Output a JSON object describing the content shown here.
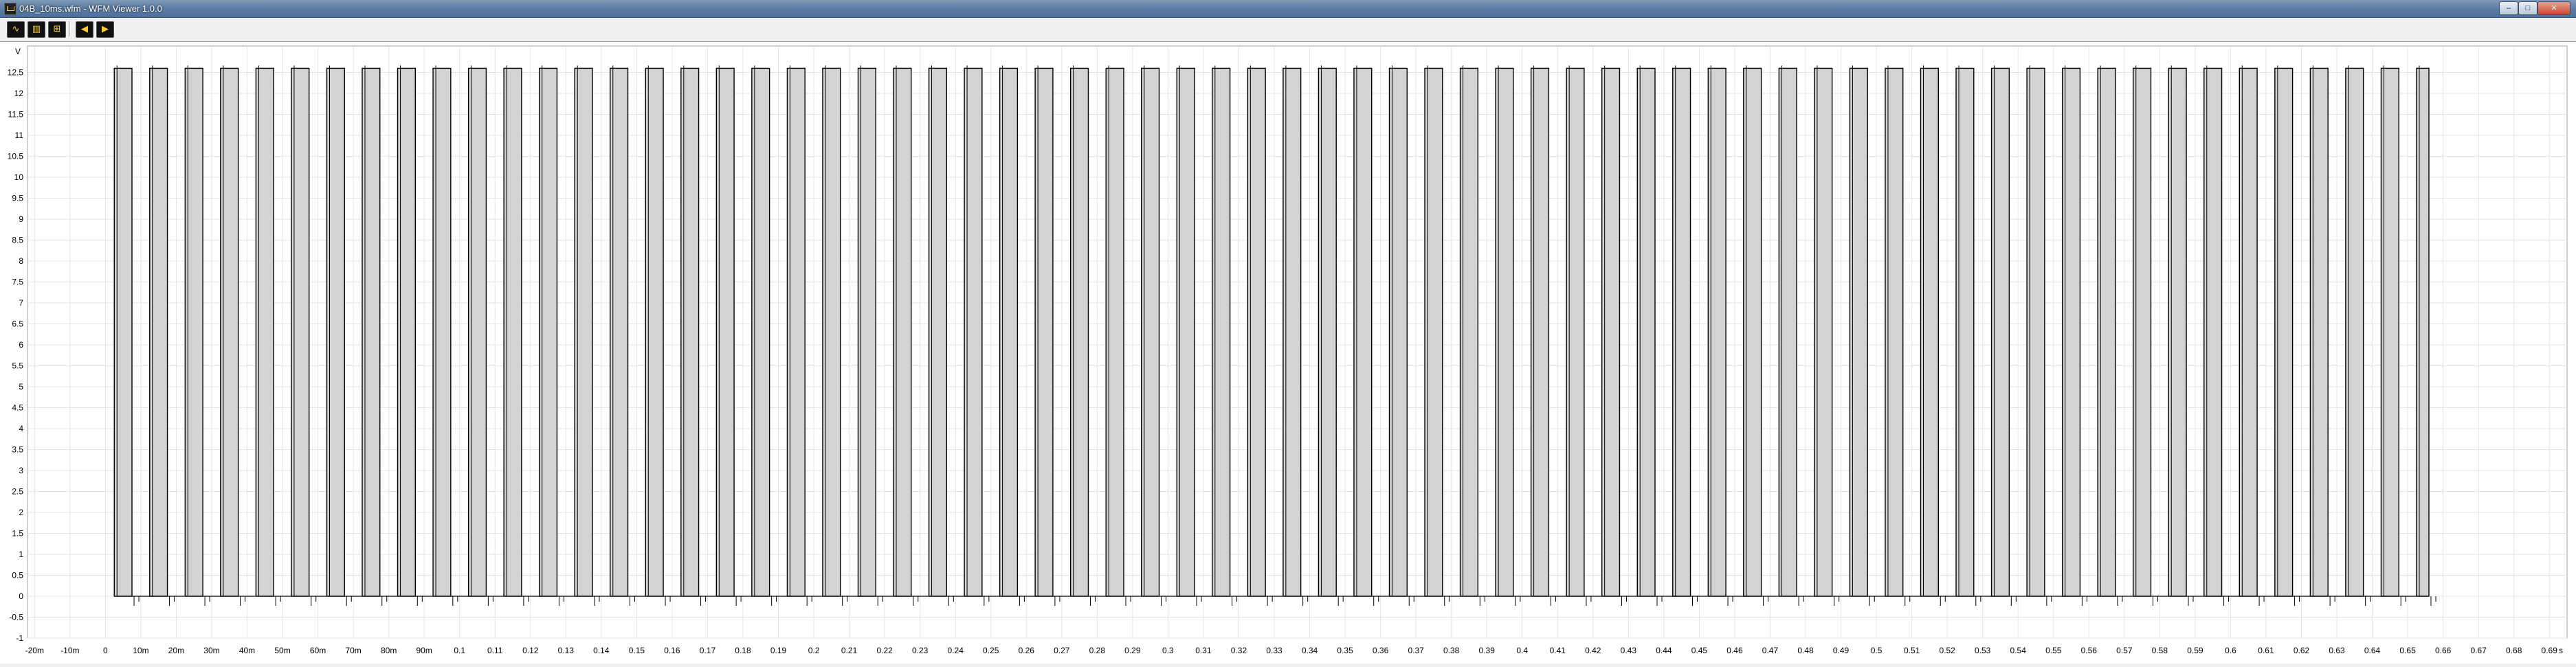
{
  "window": {
    "title": "04B_10ms.wfm - WFM Viewer 1.0.0",
    "minimize_label": "–",
    "maximize_label": "□",
    "close_label": "✕"
  },
  "toolbar": {
    "buttons": [
      {
        "name": "waveform-view-icon",
        "glyph": "∿"
      },
      {
        "name": "bar-chart-icon",
        "glyph": "▥"
      },
      {
        "name": "zoom-icon",
        "glyph": "⊞"
      },
      {
        "name": "arrow-left-icon",
        "glyph": "◀"
      },
      {
        "name": "arrow-right-icon",
        "glyph": "▶"
      }
    ]
  },
  "chart_data": {
    "type": "line",
    "ylabel": "V",
    "xlabel": "s",
    "ylim": [
      -1,
      13
    ],
    "xlim": [
      -0.022,
      0.695
    ],
    "y_ticks": [
      "-1",
      "-0.5",
      "0",
      "0.5",
      "1",
      "1.5",
      "2",
      "2.5",
      "3",
      "3.5",
      "4",
      "4.5",
      "5",
      "5.5",
      "6",
      "6.5",
      "7",
      "7.5",
      "8",
      "8.5",
      "9",
      "9.5",
      "10",
      "10.5",
      "11",
      "11.5",
      "12",
      "12.5"
    ],
    "x_ticks": [
      {
        "v": -0.02,
        "label": "-20m"
      },
      {
        "v": -0.01,
        "label": "-10m"
      },
      {
        "v": 0,
        "label": "0"
      },
      {
        "v": 0.01,
        "label": "10m"
      },
      {
        "v": 0.02,
        "label": "20m"
      },
      {
        "v": 0.03,
        "label": "30m"
      },
      {
        "v": 0.04,
        "label": "40m"
      },
      {
        "v": 0.05,
        "label": "50m"
      },
      {
        "v": 0.06,
        "label": "60m"
      },
      {
        "v": 0.07,
        "label": "70m"
      },
      {
        "v": 0.08,
        "label": "80m"
      },
      {
        "v": 0.09,
        "label": "90m"
      },
      {
        "v": 0.1,
        "label": "0.1"
      },
      {
        "v": 0.11,
        "label": "0.11"
      },
      {
        "v": 0.12,
        "label": "0.12"
      },
      {
        "v": 0.13,
        "label": "0.13"
      },
      {
        "v": 0.14,
        "label": "0.14"
      },
      {
        "v": 0.15,
        "label": "0.15"
      },
      {
        "v": 0.16,
        "label": "0.16"
      },
      {
        "v": 0.17,
        "label": "0.17"
      },
      {
        "v": 0.18,
        "label": "0.18"
      },
      {
        "v": 0.19,
        "label": "0.19"
      },
      {
        "v": 0.2,
        "label": "0.2"
      },
      {
        "v": 0.21,
        "label": "0.21"
      },
      {
        "v": 0.22,
        "label": "0.22"
      },
      {
        "v": 0.23,
        "label": "0.23"
      },
      {
        "v": 0.24,
        "label": "0.24"
      },
      {
        "v": 0.25,
        "label": "0.25"
      },
      {
        "v": 0.26,
        "label": "0.26"
      },
      {
        "v": 0.27,
        "label": "0.27"
      },
      {
        "v": 0.28,
        "label": "0.28"
      },
      {
        "v": 0.29,
        "label": "0.29"
      },
      {
        "v": 0.3,
        "label": "0.3"
      },
      {
        "v": 0.31,
        "label": "0.31"
      },
      {
        "v": 0.32,
        "label": "0.32"
      },
      {
        "v": 0.33,
        "label": "0.33"
      },
      {
        "v": 0.34,
        "label": "0.34"
      },
      {
        "v": 0.35,
        "label": "0.35"
      },
      {
        "v": 0.36,
        "label": "0.36"
      },
      {
        "v": 0.37,
        "label": "0.37"
      },
      {
        "v": 0.38,
        "label": "0.38"
      },
      {
        "v": 0.39,
        "label": "0.39"
      },
      {
        "v": 0.4,
        "label": "0.4"
      },
      {
        "v": 0.41,
        "label": "0.41"
      },
      {
        "v": 0.42,
        "label": "0.42"
      },
      {
        "v": 0.43,
        "label": "0.43"
      },
      {
        "v": 0.44,
        "label": "0.44"
      },
      {
        "v": 0.45,
        "label": "0.45"
      },
      {
        "v": 0.46,
        "label": "0.46"
      },
      {
        "v": 0.47,
        "label": "0.47"
      },
      {
        "v": 0.48,
        "label": "0.48"
      },
      {
        "v": 0.49,
        "label": "0.49"
      },
      {
        "v": 0.5,
        "label": "0.5"
      },
      {
        "v": 0.51,
        "label": "0.51"
      },
      {
        "v": 0.52,
        "label": "0.52"
      },
      {
        "v": 0.53,
        "label": "0.53"
      },
      {
        "v": 0.54,
        "label": "0.54"
      },
      {
        "v": 0.55,
        "label": "0.55"
      },
      {
        "v": 0.56,
        "label": "0.56"
      },
      {
        "v": 0.57,
        "label": "0.57"
      },
      {
        "v": 0.58,
        "label": "0.58"
      },
      {
        "v": 0.59,
        "label": "0.59"
      },
      {
        "v": 0.6,
        "label": "0.6"
      },
      {
        "v": 0.61,
        "label": "0.61"
      },
      {
        "v": 0.62,
        "label": "0.62"
      },
      {
        "v": 0.63,
        "label": "0.63"
      },
      {
        "v": 0.64,
        "label": "0.64"
      },
      {
        "v": 0.65,
        "label": "0.65"
      },
      {
        "v": 0.66,
        "label": "0.66"
      },
      {
        "v": 0.67,
        "label": "0.67"
      },
      {
        "v": 0.68,
        "label": "0.68"
      },
      {
        "v": 0.69,
        "label": "0.69"
      }
    ],
    "grid": true,
    "series": [
      {
        "high": 12.6,
        "low": 0,
        "pulse_start": 0.0025,
        "pulse_period": 0.01,
        "pulse_width": 0.005,
        "pulse_end": 0.656,
        "fill": "#d3d3d3",
        "stroke": "#000000"
      }
    ]
  }
}
